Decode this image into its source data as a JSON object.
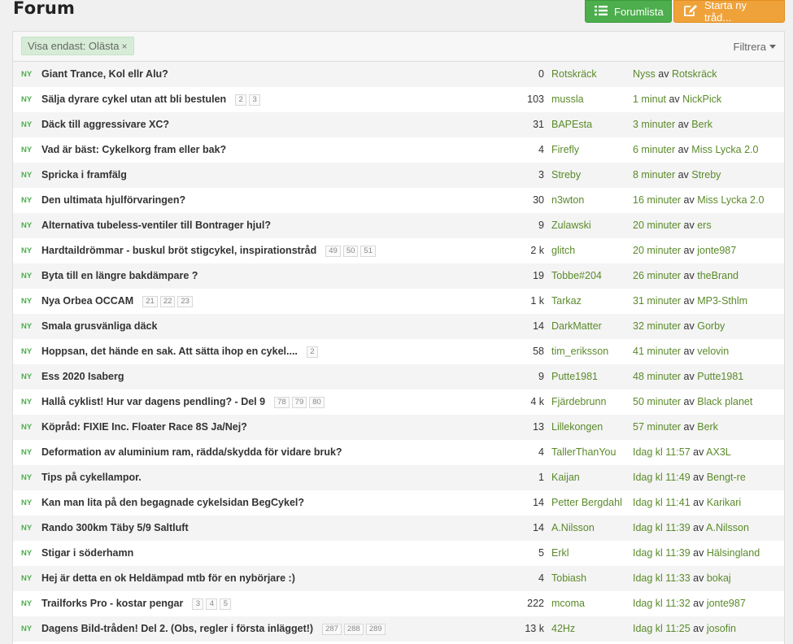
{
  "header": {
    "title": "Forum",
    "forumlist_label": "Forumlista",
    "new_thread_label": "Starta ny tråd..."
  },
  "filter": {
    "chip_label": "Visa endast: Olästa",
    "chip_close": "×",
    "filter_label": "Filtrera"
  },
  "badge_new": "NY",
  "by_word": "av",
  "threads": [
    {
      "title": "Giant Trance, Kol ellr Alu?",
      "pages": [],
      "count": "0",
      "author": "Rotskräck",
      "time": "Nyss",
      "last_user": "Rotskräck"
    },
    {
      "title": "Sälja dyrare cykel utan att bli bestulen",
      "pages": [
        "2",
        "3"
      ],
      "count": "103",
      "author": "mussla",
      "time": "1 minut",
      "last_user": "NickPick"
    },
    {
      "title": "Däck till aggressivare XC?",
      "pages": [],
      "count": "31",
      "author": "BAPEsta",
      "time": "3 minuter",
      "last_user": "Berk"
    },
    {
      "title": "Vad är bäst: Cykelkorg fram eller bak?",
      "pages": [],
      "count": "4",
      "author": "Firefly",
      "time": "6 minuter",
      "last_user": "Miss Lycka 2.0"
    },
    {
      "title": "Spricka i framfälg",
      "pages": [],
      "count": "3",
      "author": "Streby",
      "time": "8 minuter",
      "last_user": "Streby"
    },
    {
      "title": "Den ultimata hjulförvaringen?",
      "pages": [],
      "count": "30",
      "author": "n3wton",
      "time": "16 minuter",
      "last_user": "Miss Lycka 2.0"
    },
    {
      "title": "Alternativa tubeless-ventiler till Bontrager hjul?",
      "pages": [],
      "count": "9",
      "author": "Zulawski",
      "time": "20 minuter",
      "last_user": "ers"
    },
    {
      "title": "Hardtaildrömmar - buskul bröt stigcykel, inspirationstråd",
      "pages": [
        "49",
        "50",
        "51"
      ],
      "count": "2 k",
      "author": "glitch",
      "time": "20 minuter",
      "last_user": "jonte987"
    },
    {
      "title": "Byta till en längre bakdämpare ?",
      "pages": [],
      "count": "19",
      "author": "Tobbe#204",
      "time": "26 minuter",
      "last_user": "theBrand"
    },
    {
      "title": "Nya Orbea OCCAM",
      "pages": [
        "21",
        "22",
        "23"
      ],
      "count": "1 k",
      "author": "Tarkaz",
      "time": "31 minuter",
      "last_user": "MP3-Sthlm"
    },
    {
      "title": "Smala grusvänliga däck",
      "pages": [],
      "count": "14",
      "author": "DarkMatter",
      "time": "32 minuter",
      "last_user": "Gorby"
    },
    {
      "title": "Hoppsan, det hände en sak. Att sätta ihop en cykel....",
      "pages": [
        "2"
      ],
      "count": "58",
      "author": "tim_eriksson",
      "time": "41 minuter",
      "last_user": "velovin"
    },
    {
      "title": "Ess 2020 Isaberg",
      "pages": [],
      "count": "9",
      "author": "Putte1981",
      "time": "48 minuter",
      "last_user": "Putte1981"
    },
    {
      "title": "Hallå cyklist! Hur var dagens pendling? - Del 9",
      "pages": [
        "78",
        "79",
        "80"
      ],
      "count": "4 k",
      "author": "Fjärdebrunn",
      "time": "50 minuter",
      "last_user": "Black planet"
    },
    {
      "title": "Köpråd: FIXIE Inc. Floater Race 8S Ja/Nej?",
      "pages": [],
      "count": "13",
      "author": "Lillekongen",
      "time": "57 minuter",
      "last_user": "Berk"
    },
    {
      "title": "Deformation av aluminium ram, rädda/skydda för vidare bruk?",
      "pages": [],
      "count": "4",
      "author": "TallerThanYou",
      "time": "Idag kl 11:57",
      "last_user": "AX3L"
    },
    {
      "title": "Tips på cykellampor.",
      "pages": [],
      "count": "1",
      "author": "Kaijan",
      "time": "Idag kl 11:49",
      "last_user": "Bengt-re"
    },
    {
      "title": "Kan man lita på den begagnade cykelsidan BegCykel?",
      "pages": [],
      "count": "14",
      "author": "Petter Bergdahl",
      "time": "Idag kl 11:41",
      "last_user": "Karikari"
    },
    {
      "title": "Rando 300km Täby 5/9 Saltluft",
      "pages": [],
      "count": "14",
      "author": "A.Nilsson",
      "time": "Idag kl 11:39",
      "last_user": "A.Nilsson"
    },
    {
      "title": "Stigar i söderhamn",
      "pages": [],
      "count": "5",
      "author": "Erkl",
      "time": "Idag kl 11:39",
      "last_user": "Hälsingland"
    },
    {
      "title": "Hej är detta en ok Heldämpad mtb för en nybörjare :)",
      "pages": [],
      "count": "4",
      "author": "Tobiash",
      "time": "Idag kl 11:33",
      "last_user": "bokaj"
    },
    {
      "title": "Trailforks Pro - kostar pengar",
      "pages": [
        "3",
        "4",
        "5"
      ],
      "count": "222",
      "author": "mcoma",
      "time": "Idag kl 11:32",
      "last_user": "jonte987"
    },
    {
      "title": "Dagens Bild-tråden! Del 2. (Obs, regler i första inlägget!)",
      "pages": [
        "287",
        "288",
        "289"
      ],
      "count": "13 k",
      "author": "42Hz",
      "time": "Idag kl 11:25",
      "last_user": "josofin"
    }
  ],
  "colors": {
    "accent_green": "#4cae4c",
    "accent_orange": "#f0a23a",
    "link_green": "#5a8a2a"
  },
  "icons": {
    "forumlist": "list-icon",
    "new_thread": "edit-icon",
    "close": "close-icon",
    "filter": "caret-down-icon"
  }
}
